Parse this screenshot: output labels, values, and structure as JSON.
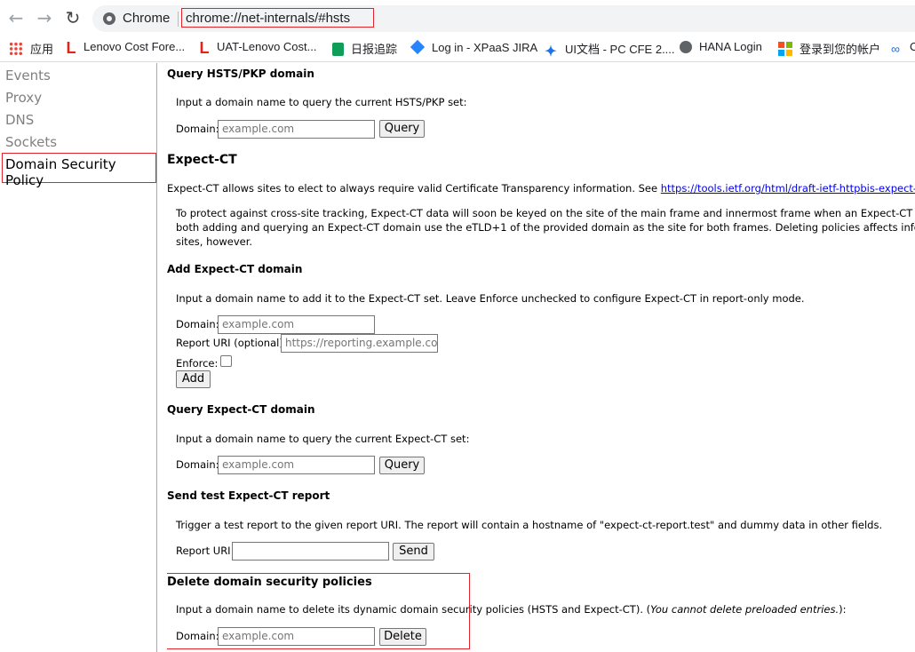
{
  "browser": {
    "chip_label": "Chrome",
    "url": "chrome://net-internals/#hsts"
  },
  "bookmarks": [
    {
      "label": "应用",
      "icon": "apps-grid-icon"
    },
    {
      "label": "Lenovo Cost Fore...",
      "icon": "lenovo-icon"
    },
    {
      "label": "UAT-Lenovo Cost...",
      "icon": "lenovo-icon"
    },
    {
      "label": "日报追踪",
      "icon": "sheet-icon"
    },
    {
      "label": "Log in - XPaaS JIRA",
      "icon": "jira-icon"
    },
    {
      "label": "UI文档 - PC CFE 2....",
      "icon": "confluence-icon"
    },
    {
      "label": "HANA Login",
      "icon": "globe-icon"
    },
    {
      "label": "登录到您的帐户",
      "icon": "microsoft-icon"
    },
    {
      "label": "C",
      "icon": "link-icon"
    }
  ],
  "sidebar": {
    "items": [
      "Events",
      "Proxy",
      "DNS",
      "Sockets",
      "Domain Security Policy"
    ]
  },
  "query_hsts": {
    "title": "Query HSTS/PKP domain",
    "desc": "Input a domain name to query the current HSTS/PKP set:",
    "domain_label": "Domain:",
    "placeholder": "example.com",
    "button": "Query"
  },
  "expect_ct": {
    "title": "Expect-CT",
    "intro": "Expect-CT allows sites to elect to always require valid Certificate Transparency information. See",
    "link": "https://tools.ietf.org/html/draft-ietf-httpbis-expect-ct",
    "intro_end": ".",
    "note_lines": [
      "To protect against cross-site tracking, Expect-CT data will soon be keyed on the site of the main frame and innermost frame when an Expect-CT header is enco",
      "both adding and querying an Expect-CT domain use the eTLD+1 of the provided domain as the site for both frames. Deleting policies affects information stor",
      "sites, however."
    ]
  },
  "add_ct": {
    "title": "Add Expect-CT domain",
    "desc": "Input a domain name to add it to the Expect-CT set. Leave Enforce unchecked to configure Expect-CT in report-only mode.",
    "domain_label": "Domain:",
    "domain_placeholder": "example.com",
    "report_label": "Report URI (optional):",
    "report_placeholder": "https://reporting.example.com",
    "enforce_label": "Enforce:",
    "button": "Add"
  },
  "query_ct": {
    "title": "Query Expect-CT domain",
    "desc": "Input a domain name to query the current Expect-CT set:",
    "domain_label": "Domain:",
    "placeholder": "example.com",
    "button": "Query"
  },
  "send_test": {
    "title": "Send test Expect-CT report",
    "desc": "Trigger a test report to the given report URI. The report will contain a hostname of \"expect-ct-report.test\" and dummy data in other fields.",
    "label": "Report URI:",
    "button": "Send"
  },
  "delete": {
    "title": "Delete domain security policies",
    "desc_start": "Input a domain name to delete its dynamic domain security policies (HSTS and Expect-CT). (",
    "desc_italic": "You cannot delete preloaded entries.",
    "desc_end": "):",
    "domain_label": "Domain:",
    "placeholder": "example.com",
    "button": "Delete"
  }
}
